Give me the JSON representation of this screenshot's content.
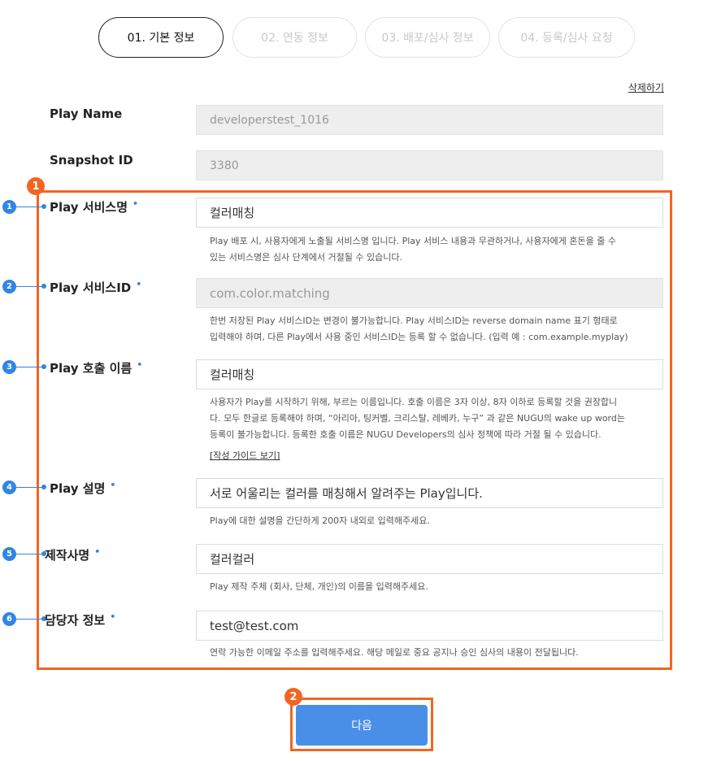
{
  "steps": [
    "01. 기본 정보",
    "02. 연동 정보",
    "03. 배포/심사 정보",
    "04. 등록/심사 요청"
  ],
  "delete_link": "삭제하기",
  "fields": {
    "play_name": {
      "label": "Play Name",
      "value": "developerstest_1016"
    },
    "snapshot_id": {
      "label": "Snapshot ID",
      "value": "3380"
    },
    "service_name": {
      "label": "Play 서비스명",
      "required": "•",
      "marker": "1",
      "value": "컬러매칭",
      "help": [
        "Play 배포 시, 사용자에게 노출될 서비스명 입니다. Play 서비스 내용과 무관하거나, 사용자에게 혼돈을 줄 수",
        "있는 서비스명은 심사 단계에서 거절될 수 있습니다."
      ]
    },
    "service_id": {
      "label": "Play 서비스ID",
      "required": "•",
      "marker": "2",
      "value": "com.color.matching",
      "help": [
        "한번 저장된 Play 서비스ID는 변경이 불가능합니다. Play 서비스ID는 reverse domain name 표기 형태로",
        "입력해야 하며, 다른 Play에서 사용 중인 서비스ID는 등록 할 수 없습니다. (입력 예 : com.example.myplay)"
      ]
    },
    "call_name": {
      "label": "Play 호출 이름",
      "required": "•",
      "marker": "3",
      "value": "컬러매칭",
      "help": [
        "사용자가 Play를 시작하기 위해, 부르는 이름입니다. 호출 이름은 3자 이상, 8자 이하로 등록할 것을 권장합니",
        "다. 모두 한글로 등록해야 하며, “아리아, 팅커벨, 크리스탈, 레베카, 누구” 과 같은 NUGU의 wake up word는",
        "등록이 불가능합니다. 등록한 호출 이름은 NUGU Developers의 심사 정책에 따라 거절 될 수 있습니다."
      ],
      "guide_link": "[작성 가이드 보기]"
    },
    "description": {
      "label": "Play 설명",
      "required": "•",
      "marker": "4",
      "value": "서로 어울리는 컬러를 매칭해서 알려주는 Play입니다.",
      "help": [
        "Play에 대한 설명을 간단하게 200자 내외로 입력해주세요."
      ]
    },
    "maker": {
      "label": "제작사명",
      "required": "•",
      "marker": "5",
      "value": "컬러컬러",
      "help": [
        "Play 제작 주체 (회사, 단체, 개인)의 이름을 입력해주세요."
      ]
    },
    "contact": {
      "label": "담당자 정보",
      "required": "•",
      "marker": "6",
      "value": "test@test.com",
      "help": [
        "연락 가능한 이메일 주소를 입력해주세요. 해당 메일로 중요 공지나 승인 심사의 내용이 전달됩니다."
      ]
    }
  },
  "callouts": {
    "box": "1",
    "button": "2"
  },
  "next_button": "다음",
  "colors": {
    "accent_orange": "#f26522",
    "marker_blue": "#2f86e6",
    "button_blue": "#4a8fe7"
  }
}
